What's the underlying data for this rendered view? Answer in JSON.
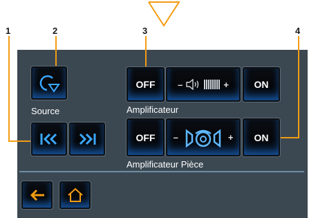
{
  "callouts": [
    "1",
    "2",
    "3",
    "4"
  ],
  "source": {
    "label": "Source"
  },
  "amplifier": {
    "label": "Amplificateur",
    "off_label": "OFF",
    "on_label": "ON",
    "minus": "–",
    "plus": "+"
  },
  "room_amplifier": {
    "label": "Amplificateur Pièce",
    "off_label": "OFF",
    "on_label": "ON",
    "minus": "–",
    "plus": "+"
  },
  "colors": {
    "panel": "#3b4852",
    "accent_orange": "#f39c12",
    "glow_blue": "#1e78e6"
  },
  "icons": {
    "source": "source-cycle-icon",
    "prev": "previous-track-icon",
    "next": "next-track-icon",
    "back": "back-arrow-icon",
    "home": "home-icon",
    "volume": "speaker-volume-icon",
    "room": "room-speakers-icon"
  }
}
